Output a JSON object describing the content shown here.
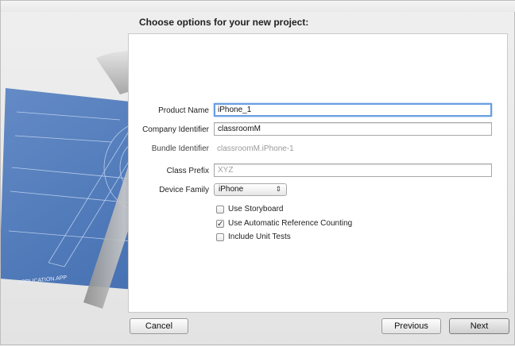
{
  "dialog": {
    "header": "Choose options for your new project:"
  },
  "form": {
    "product_name": {
      "label": "Product Name",
      "value": "iPhone_1"
    },
    "company_identifier": {
      "label": "Company Identifier",
      "value": "classroomM"
    },
    "bundle_identifier": {
      "label": "Bundle Identifier",
      "value": "classroomM.iPhone-1"
    },
    "class_prefix": {
      "label": "Class Prefix",
      "placeholder": "XYZ"
    },
    "device_family": {
      "label": "Device Family",
      "selected": "iPhone",
      "arrows_icon": "up-down-arrows-icon"
    },
    "options": [
      {
        "label": "Use Storyboard",
        "checked": false
      },
      {
        "label": "Use Automatic Reference Counting",
        "checked": true
      },
      {
        "label": "Include Unit Tests",
        "checked": false
      }
    ]
  },
  "buttons": {
    "cancel": "Cancel",
    "previous": "Previous",
    "next": "Next"
  },
  "artwork": {
    "blueprint_text": "APPLICATION.APP",
    "icon": "xcode-hammer-blueprint-icon"
  },
  "colors": {
    "focus_ring": "#6a9de0",
    "blueprint": "#3f6fb5"
  }
}
